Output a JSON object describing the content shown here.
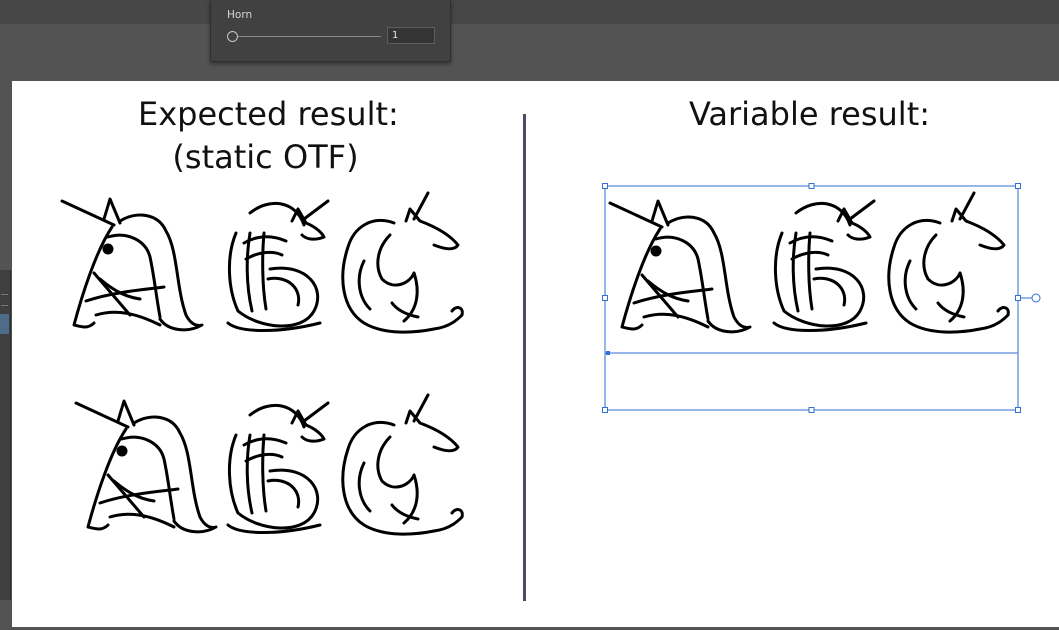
{
  "horn_panel": {
    "label": "Horn",
    "value": "1",
    "slider_level": 0.0
  },
  "artboard": {
    "left_heading_line1": "Expected result:",
    "left_heading_line2": "(static OTF)",
    "right_heading": "Variable result:"
  },
  "colors": {
    "app_background": "#535353",
    "panel_background": "#414141",
    "artboard": "#ffffff",
    "divider": "#4a4a6a",
    "selection": "#2f6fd6"
  },
  "icons": {
    "slider_knob": "circle-handle",
    "glyph_a": "unicorn-letter-a",
    "glyph_b": "unicorn-letter-b",
    "glyph_c": "unicorn-letter-c"
  }
}
